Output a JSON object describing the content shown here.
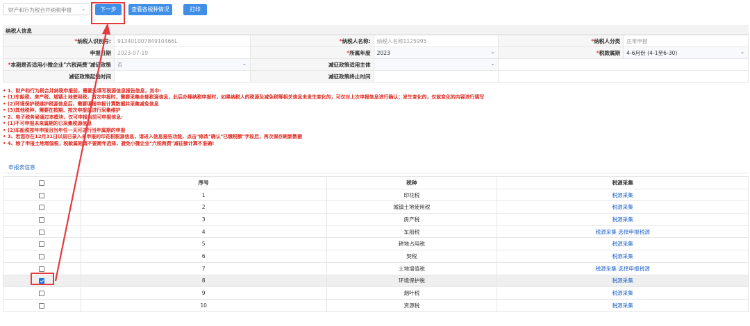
{
  "toolbar": {
    "mode_select": "财产和行为税合并纳税申报",
    "next_button": "下一步",
    "view_button": "查看各税种情况",
    "print_button": "打印"
  },
  "taxpayer": {
    "section_title": "纳税人信息",
    "id_label": "纳税人识别号:",
    "id_value": "91340100784910466L",
    "name_label": "纳税人名称:",
    "name_value": "纳税人名称1125995",
    "category_label": "纳税人分类",
    "category_value": "正常申报",
    "date_label": "申报日期",
    "date_value": "2023-07-19",
    "year_label": "所属年度",
    "year_value": "2023",
    "period_label": "税款属期",
    "period_value": "4-6月份 (4-1至6-30)",
    "smallbiz_label": "本期是否适用小微企业\"六税两费\"减征政策",
    "smallbiz_value": "否",
    "subject_label": "减征政策适用主体",
    "subject_value": "",
    "start_label": "减征政策起始时间",
    "start_value": "",
    "end_label": "减征政策终止时间",
    "end_value": "",
    "required_mark": "*"
  },
  "notes": [
    "1、财产和行为税合并纳税申报前，需要先填写税源信息报告信息，其中:",
    "(1)车船税、房产税、城镇土地使用税，首次申报时，需要采集全部税源信息，此后办理纳税申报时，如果纳税人的税源及减免税等相关信息未发生变化的，可仅对上次申报信息进行确认；发生变化的，仅就变化的内容进行填写",
    "(2)环境保护税维护税源信息后，需要填报申报计算数据并采集减免信息",
    "(3)其他税种，需要在按期、按次申报前进行采集维护",
    "2、电子税务局通过本模块，仅可申报当前可申报信息:",
    "(1)不可申报未来属期的已采集税源信息",
    "(2)车船税按年申报且当年任一天可进行当年属期的申报",
    "3、若您存在12月31日以前已录入未申报的印花税税源信息，请进入信息报告功能，点击\"修改\"确认\"已缴税额\"字段后，再次保存刷新数据",
    "4、除了申报土地增值税，税款属期请不要跨年选择，避免小微企业\"六税两费\"减征额计算不准确!"
  ],
  "declaration": {
    "subtitle": "申报表信息",
    "headers": {
      "index": "序号",
      "tax_type": "税种",
      "collect": "税源采集"
    },
    "rows": [
      {
        "index": "1",
        "tax_type": "印花税",
        "link1": "税源采集",
        "link2": "",
        "checked": false
      },
      {
        "index": "2",
        "tax_type": "城镇土地使用税",
        "link1": "税源采集",
        "link2": "",
        "checked": false
      },
      {
        "index": "3",
        "tax_type": "房产税",
        "link1": "税源采集",
        "link2": "",
        "checked": false
      },
      {
        "index": "4",
        "tax_type": "车船税",
        "link1": "税源采集",
        "link2": "选择申报税源",
        "checked": false
      },
      {
        "index": "5",
        "tax_type": "耕地占用税",
        "link1": "税源采集",
        "link2": "",
        "checked": false
      },
      {
        "index": "6",
        "tax_type": "契税",
        "link1": "税源采集",
        "link2": "",
        "checked": false
      },
      {
        "index": "7",
        "tax_type": "土地增值税",
        "link1": "税源采集",
        "link2": "选择申报税源",
        "checked": false
      },
      {
        "index": "8",
        "tax_type": "环境保护税",
        "link1": "税源采集",
        "link2": "",
        "checked": true
      },
      {
        "index": "9",
        "tax_type": "烟叶税",
        "link1": "税源采集",
        "link2": "",
        "checked": false
      },
      {
        "index": "10",
        "tax_type": "资源税",
        "link1": "税源采集",
        "link2": "",
        "checked": false
      }
    ]
  },
  "colors": {
    "primary": "#3f8ee8",
    "annotation": "#e5393e",
    "notes": "#e0261c",
    "link": "#1a5fc7"
  },
  "icons": {
    "dropdown": "chevron-down-icon",
    "annotation": "arrow-annotation-icon"
  }
}
